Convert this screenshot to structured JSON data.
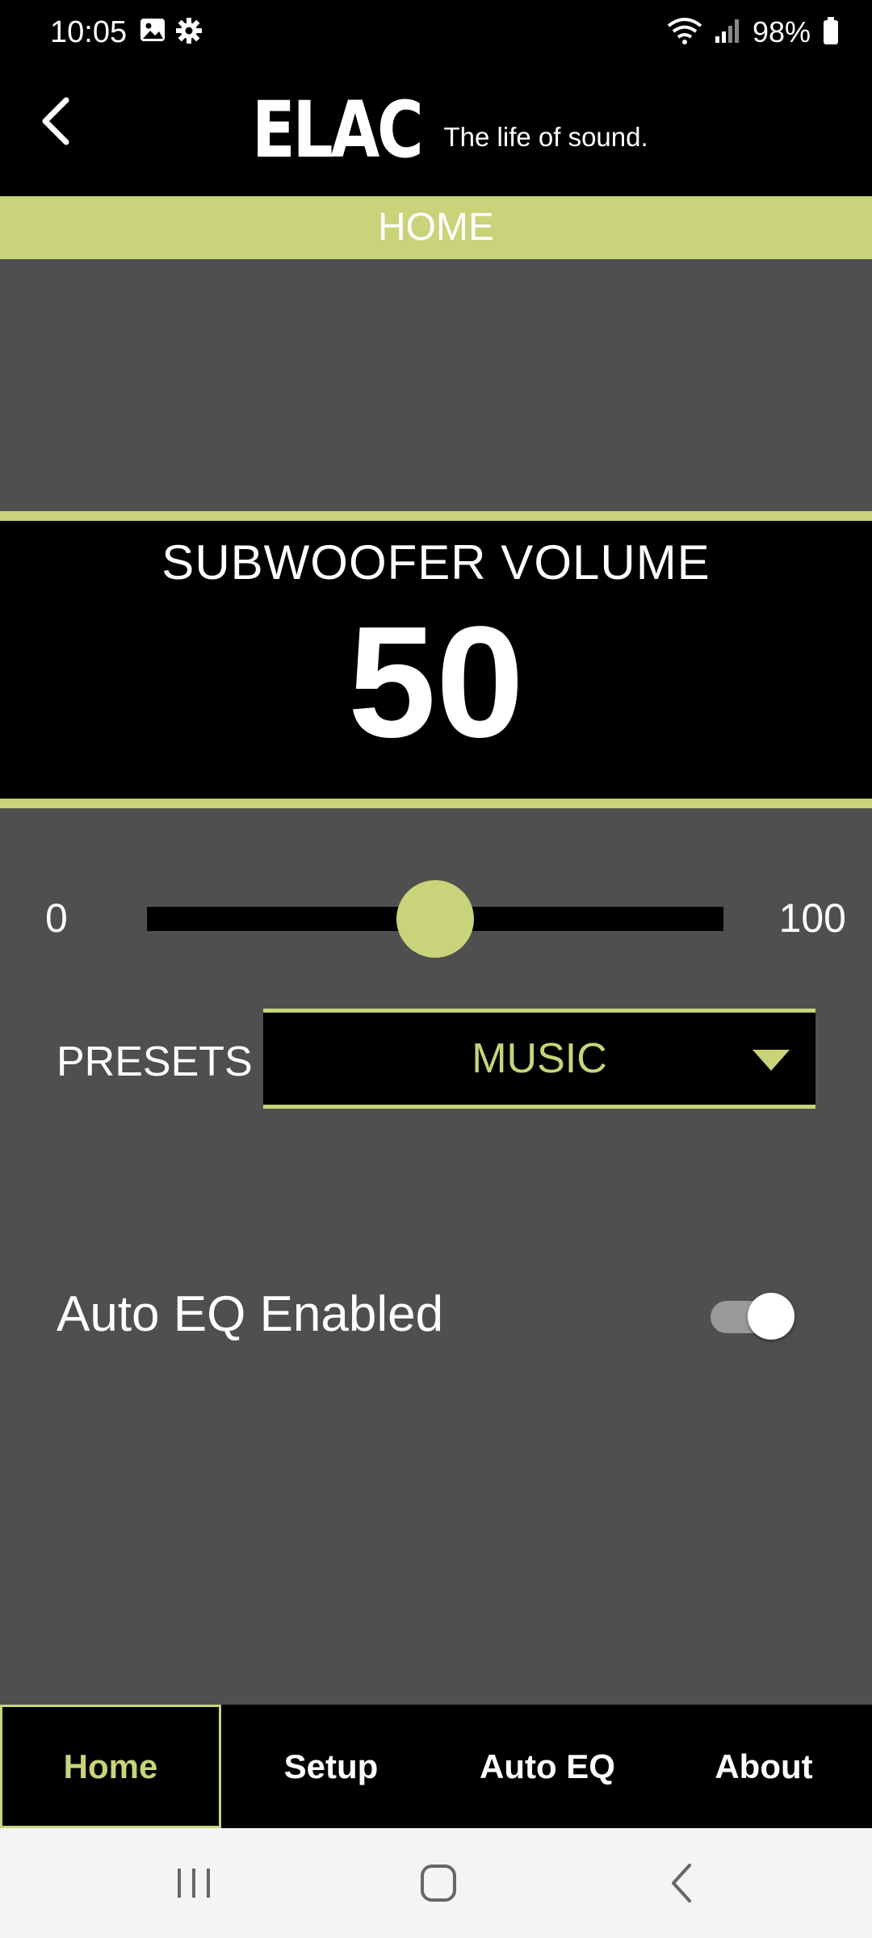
{
  "status_bar": {
    "time": "10:05",
    "battery": "98%",
    "icons": [
      "gallery-icon",
      "settings-icon",
      "wifi-icon",
      "signal-icon",
      "battery-icon"
    ]
  },
  "header": {
    "logo_text": "ELAC",
    "tagline": "The life of sound.",
    "back_icon": "chevron-left-icon"
  },
  "page_title": "HOME",
  "volume": {
    "label": "SUBWOOFER VOLUME",
    "value": "50",
    "slider_min": "0",
    "slider_max": "100",
    "slider_fraction": 0.5
  },
  "presets": {
    "label": "PRESETS",
    "selected": "MUSIC"
  },
  "auto_eq": {
    "label": "Auto EQ Enabled",
    "enabled": true
  },
  "bottom_nav": {
    "tabs": [
      {
        "label": "Home",
        "active": true
      },
      {
        "label": "Setup",
        "active": false
      },
      {
        "label": "Auto EQ",
        "active": false
      },
      {
        "label": "About",
        "active": false
      }
    ]
  },
  "colors": {
    "accent": "#c9d37a",
    "background": "#4f4f4f",
    "panel": "#000000"
  }
}
